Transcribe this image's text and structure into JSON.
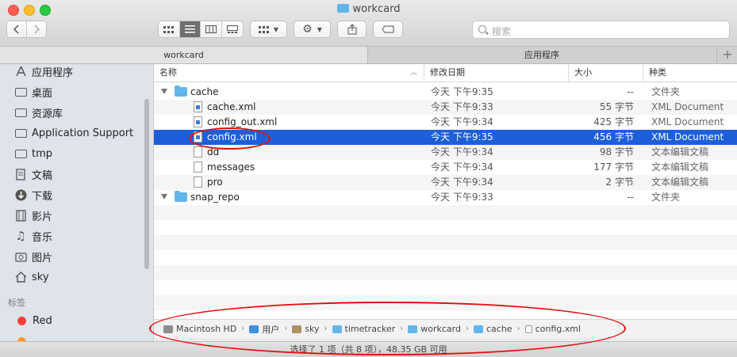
{
  "window": {
    "title": "workcard"
  },
  "toolbar": {
    "search_placeholder": "搜索"
  },
  "tabs": [
    {
      "label": "workcard",
      "active": true
    },
    {
      "label": "应用程序",
      "active": false
    }
  ],
  "sidebar": {
    "items": [
      {
        "label": "应用程序",
        "icon": "applications-icon"
      },
      {
        "label": "桌面",
        "icon": "desktop-icon"
      },
      {
        "label": "资源库",
        "icon": "folder-icon"
      },
      {
        "label": "Application Support",
        "icon": "folder-icon"
      },
      {
        "label": "tmp",
        "icon": "folder-icon"
      },
      {
        "label": "文稿",
        "icon": "documents-icon"
      },
      {
        "label": "下载",
        "icon": "downloads-icon"
      },
      {
        "label": "影片",
        "icon": "movies-icon"
      },
      {
        "label": "音乐",
        "icon": "music-icon"
      },
      {
        "label": "图片",
        "icon": "pictures-icon"
      },
      {
        "label": "sky",
        "icon": "home-icon"
      }
    ],
    "tags_header": "标签",
    "tags": [
      {
        "label": "Red",
        "color": "#fc3d39"
      }
    ]
  },
  "columns": {
    "name": "名称",
    "date": "修改日期",
    "size": "大小",
    "kind": "种类"
  },
  "files": [
    {
      "name": "cache",
      "date": "今天 下午9:35",
      "size": "--",
      "kind": "文件夹"
    },
    {
      "name": "cache.xml",
      "date": "今天 下午9:33",
      "size": "55 字节",
      "kind": "XML Document"
    },
    {
      "name": "config_out.xml",
      "date": "今天 下午9:34",
      "size": "425 字节",
      "kind": "XML Document"
    },
    {
      "name": "config.xml",
      "date": "今天 下午9:35",
      "size": "456 字节",
      "kind": "XML Document"
    },
    {
      "name": "dd",
      "date": "今天 下午9:34",
      "size": "98 字节",
      "kind": "文本编辑文稿"
    },
    {
      "name": "messages",
      "date": "今天 下午9:34",
      "size": "177 字节",
      "kind": "文本编辑文稿"
    },
    {
      "name": "pro",
      "date": "今天 下午9:34",
      "size": "2 字节",
      "kind": "文本编辑文稿"
    },
    {
      "name": "snap_repo",
      "date": "今天 下午9:33",
      "size": "--",
      "kind": "文件夹"
    }
  ],
  "path": [
    "Macintosh HD",
    "用户",
    "sky",
    "timetracker",
    "workcard",
    "cache",
    "config.xml"
  ],
  "status": "选择了 1 项（共 8 项），48.35 GB 可用",
  "colors": {
    "selection": "#1c5fd8",
    "annotation": "#e01010"
  }
}
